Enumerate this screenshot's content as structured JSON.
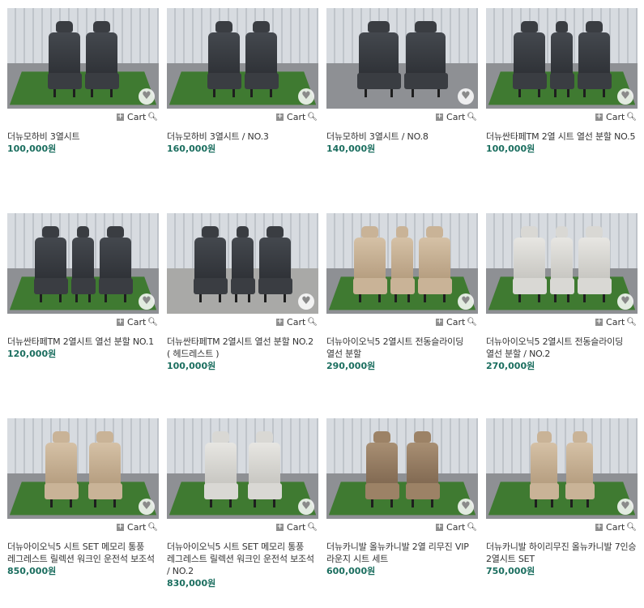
{
  "colors": {
    "price": "#1b6e5f",
    "text": "#333333"
  },
  "cart_label": "Cart",
  "products": [
    {
      "title": "더뉴모하비 3열시트",
      "price": "100,000원",
      "seat_color": "dark"
    },
    {
      "title": "더뉴모하비 3열시트 / NO.3",
      "price": "160,000원",
      "seat_color": "dark"
    },
    {
      "title": "더뉴모하비 3열시트 / NO.8",
      "price": "140,000원",
      "seat_color": "dark"
    },
    {
      "title": "더뉴싼타페TM 2열 시트 열선 분할 NO.5",
      "price": "100,000원",
      "seat_color": "dark"
    },
    {
      "title": "더뉴싼타페TM 2열시트 열선 분할 NO.1",
      "price": "120,000원",
      "seat_color": "dark"
    },
    {
      "title": "더뉴싼타페TM 2열시트 열선 분할 NO.2 ( 헤드레스트 )",
      "price": "100,000원",
      "seat_color": "dark"
    },
    {
      "title": "더뉴아이오닉5 2열시트 전동슬라이딩 열선 분할",
      "price": "290,000원",
      "seat_color": "tan"
    },
    {
      "title": "더뉴아이오닉5 2열시트 전동슬라이딩 열선 분할 / NO.2",
      "price": "270,000원",
      "seat_color": "grey"
    },
    {
      "title": "더뉴아이오닉5 시트 SET 메모리 통풍 레그레스트 릴렉션 워크인 운전석 보조석",
      "price": "850,000원",
      "seat_color": "tan"
    },
    {
      "title": "더뉴아이오닉5 시트 SET 메모리 통풍 레그레스트 릴렉션 워크인 운전석 보조석 / NO.2",
      "price": "830,000원",
      "seat_color": "grey"
    },
    {
      "title": "더뉴카니발 올뉴카니발 2열 리무진 VIP 라운지 시트 세트",
      "price": "600,000원",
      "seat_color": "brown"
    },
    {
      "title": "더뉴카니발 하이리무진 올뉴카니발 7인승 2열시트 SET",
      "price": "750,000원",
      "seat_color": "tan"
    }
  ]
}
